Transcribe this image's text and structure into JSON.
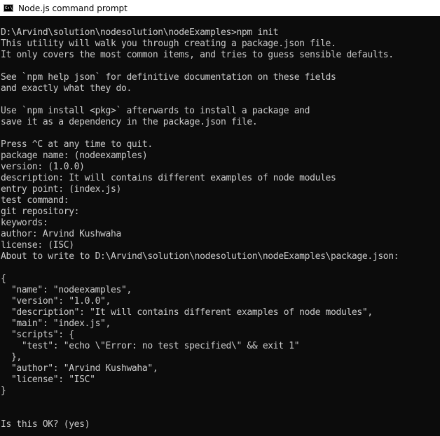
{
  "window": {
    "title": "Node.js command prompt",
    "icon": "console-icon",
    "icon_text": "C:\\"
  },
  "console": {
    "lines": [
      "D:\\Arvind\\solution\\nodesolution\\nodeExamples>npm init",
      "This utility will walk you through creating a package.json file.",
      "It only covers the most common items, and tries to guess sensible defaults.",
      "",
      "See `npm help json` for definitive documentation on these fields",
      "and exactly what they do.",
      "",
      "Use `npm install <pkg>` afterwards to install a package and",
      "save it as a dependency in the package.json file.",
      "",
      "Press ^C at any time to quit.",
      "package name: (nodeexamples)",
      "version: (1.0.0)",
      "description: It will contains different examples of node modules",
      "entry point: (index.js)",
      "test command:",
      "git repository:",
      "keywords:",
      "author: Arvind Kushwaha",
      "license: (ISC)",
      "About to write to D:\\Arvind\\solution\\nodesolution\\nodeExamples\\package.json:",
      "",
      "{",
      "  \"name\": \"nodeexamples\",",
      "  \"version\": \"1.0.0\",",
      "  \"description\": \"It will contains different examples of node modules\",",
      "  \"main\": \"index.js\",",
      "  \"scripts\": {",
      "    \"test\": \"echo \\\"Error: no test specified\\\" && exit 1\"",
      "  },",
      "  \"author\": \"Arvind Kushwaha\",",
      "  \"license\": \"ISC\"",
      "}",
      "",
      "",
      "Is this OK? (yes)"
    ]
  },
  "colors": {
    "console_background": "#0c0c0c",
    "console_text": "#cccccc",
    "titlebar_background": "#ffffff",
    "titlebar_text": "#000000"
  }
}
